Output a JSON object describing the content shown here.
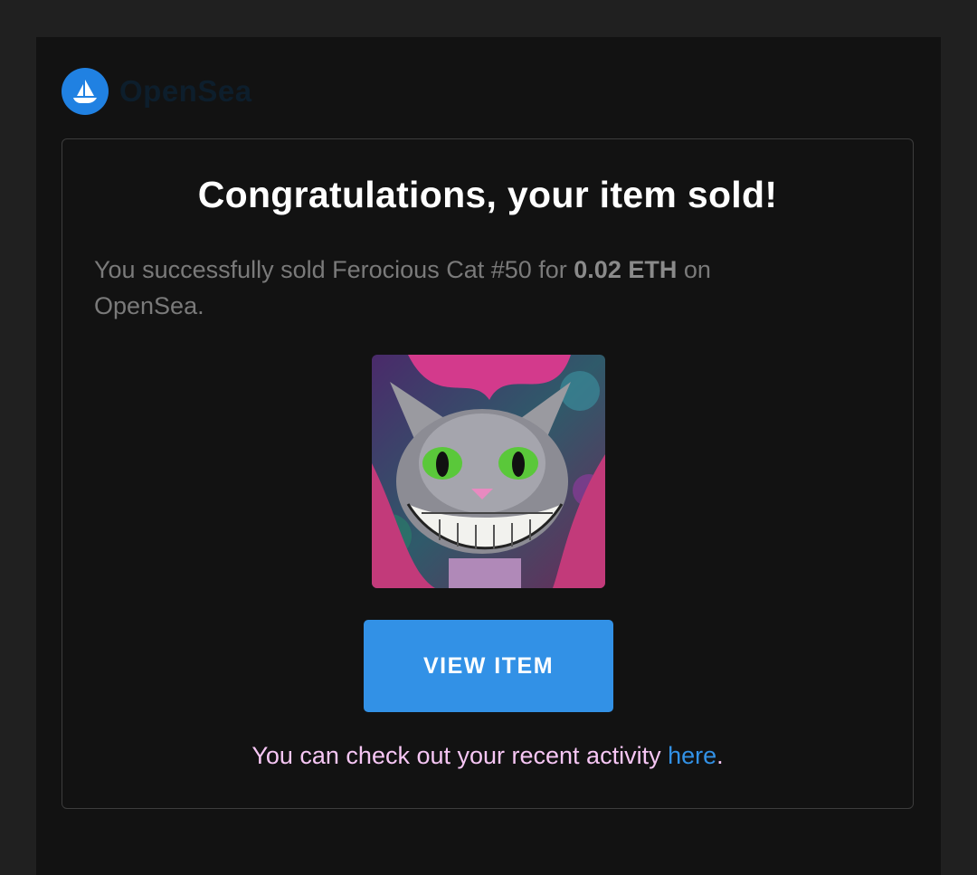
{
  "brand": {
    "name": "OpenSea",
    "accent_color": "#2081e2"
  },
  "email": {
    "headline": "Congratulations, your item sold!",
    "message_prefix": "You successfully sold Ferocious Cat #50 for ",
    "price": "0.02 ETH",
    "message_suffix": " on OpenSea.",
    "item_image_icon": "cheshire-cat-artwork",
    "button_label": "VIEW ITEM",
    "button_color": "#3291e6",
    "footer_prefix": "You can check out your recent activity ",
    "footer_link": "here",
    "footer_suffix": "."
  }
}
